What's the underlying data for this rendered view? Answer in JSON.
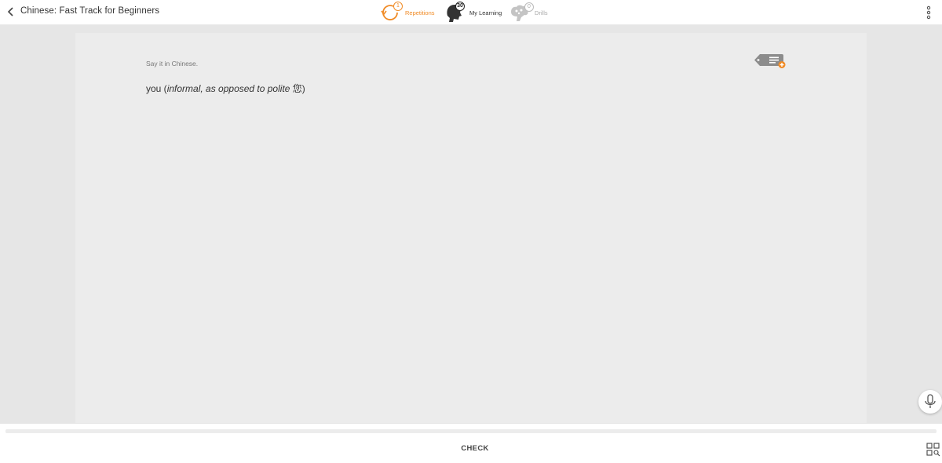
{
  "header": {
    "course_title": "Chinese: Fast Track for Beginners",
    "nav": {
      "repetitions": {
        "label": "Repetitions",
        "count": "1",
        "icon": "repetitions-icon",
        "color": "#f08a24"
      },
      "my_learning": {
        "label": "My Learning",
        "count": "30",
        "icon": "head-icon",
        "color": "#333333"
      },
      "drills": {
        "label": "Drills",
        "count": "0",
        "icon": "brain-icon",
        "color": "#aaaaaa"
      }
    }
  },
  "card": {
    "prompt": "Say it in Chinese.",
    "phrase_prefix": "you (",
    "phrase_note": "informal, as opposed to polite",
    "phrase_char": " 您",
    "phrase_suffix": ")"
  },
  "footer": {
    "check_label": "CHECK",
    "progress": 0
  },
  "colors": {
    "accent": "#f08a24",
    "panel": "#ececec",
    "background": "#e6e6e6"
  }
}
